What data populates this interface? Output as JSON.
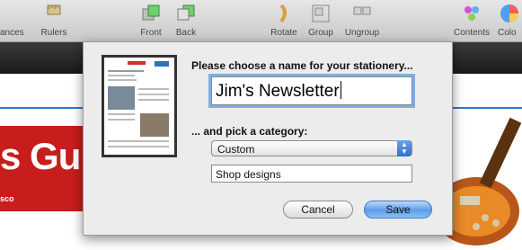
{
  "toolbar": {
    "items": [
      {
        "label": "ances",
        "icon": "inspector-icon"
      },
      {
        "label": "Rulers",
        "icon": "ruler-icon"
      },
      {
        "label": "Front",
        "icon": "front-icon"
      },
      {
        "label": "Back",
        "icon": "back-icon"
      },
      {
        "label": "Rotate",
        "icon": "rotate-icon"
      },
      {
        "label": "Group",
        "icon": "group-icon"
      },
      {
        "label": "Ungroup",
        "icon": "ungroup-icon"
      },
      {
        "label": "Contents",
        "icon": "contents-icon"
      },
      {
        "label": "Colo",
        "icon": "color-wheel-icon"
      }
    ]
  },
  "background": {
    "guitars_text": "s Guitars",
    "guitars_sub": "sco"
  },
  "dialog": {
    "prompt": "Please choose a name for your stationery...",
    "name_value": "Jim's Newsletter",
    "category_label": "... and pick a category:",
    "category_selected": "Custom",
    "subcategory_value": "Shop designs",
    "cancel_label": "Cancel",
    "save_label": "Save"
  },
  "colors": {
    "accent": "#2f78c9",
    "brand_red": "#c71d1d",
    "focus_ring": "#7eaee6"
  }
}
